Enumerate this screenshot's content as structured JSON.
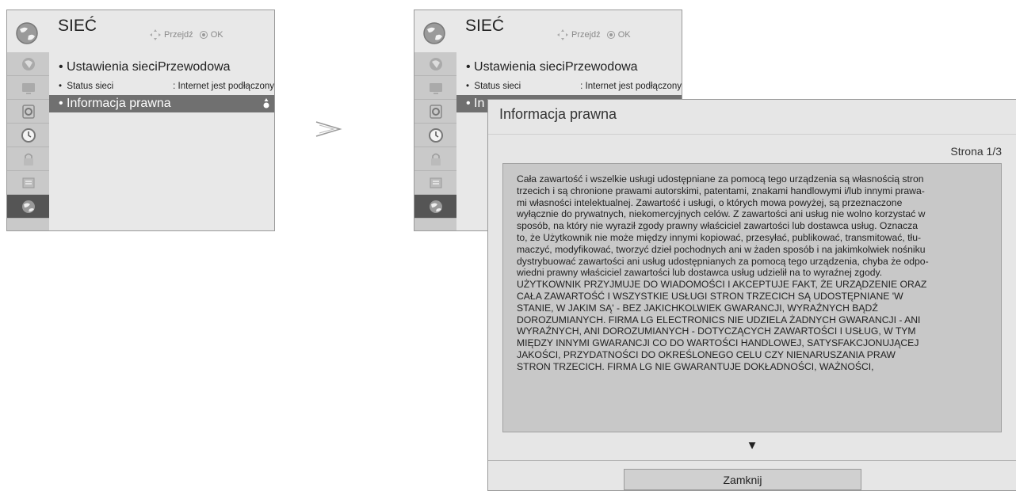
{
  "menu": {
    "title": "SIEĆ",
    "hint_move": "Przejdź",
    "hint_ok": "OK",
    "items": [
      {
        "label": "Ustawienia sieci",
        "value": ": Przewodowa"
      },
      {
        "label": "Status sieci",
        "value": ": Internet jest podłączony"
      },
      {
        "label": "Informacja prawna"
      }
    ],
    "partial_item": "• In"
  },
  "icons": [
    "globe-icon",
    "picture-icon",
    "audio-icon",
    "clock-icon",
    "lock-icon",
    "option-icon",
    "network-icon"
  ],
  "dialog": {
    "title": "Informacja prawna",
    "page": "Strona 1/3",
    "lines": [
      "Cała zawartość i wszelkie usługi udostępniane za pomocą tego urządzenia są własnością stron",
      "trzecich i są chronione prawami autorskimi, patentami, znakami handlowymi i/lub innymi prawa-",
      "mi własności intelektualnej. Zawartość i usługi, o których mowa powyżej, są przeznaczone",
      "wyłącznie do prywatnych, niekomercyjnych celów. Z zawartości ani usług nie wolno korzystać w",
      "sposób, na który nie wyraził zgody prawny właściciel zawartości lub dostawca usług. Oznacza",
      "to, że Użytkownik nie może między innymi kopiować, przesyłać, publikować, transmitować, tłu-",
      "maczyć, modyfikować, tworzyć dzieł pochodnych ani w żaden sposób i na jakimkolwiek nośniku",
      "dystrybuować zawartości ani usług udostępnianych za pomocą tego urządzenia, chyba że odpo-",
      "wiedni prawny właściciel zawartości lub dostawca usług udzielił na to wyraźnej zgody.",
      "UŻYTKOWNIK PRZYJMUJE DO WIADOMOŚCI I AKCEPTUJE FAKT, ŻE URZĄDZENIE ORAZ",
      "CAŁA ZAWARTOŚĆ I WSZYSTKIE USŁUGI STRON TRZECICH SĄ UDOSTĘPNIANE 'W",
      "STANIE, W JAKIM SĄ' - BEZ JAKICHKOLWIEK GWARANCJI, WYRAŹNYCH BĄDŹ",
      "DOROZUMIANYCH. FIRMA LG ELECTRONICS NIE UDZIELA ŻADNYCH GWARANCJI - ANI",
      "WYRAŹNYCH, ANI DOROZUMIANYCH - DOTYCZĄCYCH ZAWARTOŚCI I USŁUG, W TYM",
      "MIĘDZY INNYMI GWARANCJI CO DO WARTOŚCI HANDLOWEJ, SATYSFAKCJONUJĄCEJ",
      "JAKOŚCI, PRZYDATNOŚCI DO OKREŚLONEGO CELU CZY NIENARUSZANIA PRAW",
      "STRON TRZECICH. FIRMA LG NIE GWARANTUJE DOKŁADNOŚCI, WAŻNOŚCI,"
    ],
    "down_arrow": "▼",
    "close_label": "Zamknij"
  }
}
